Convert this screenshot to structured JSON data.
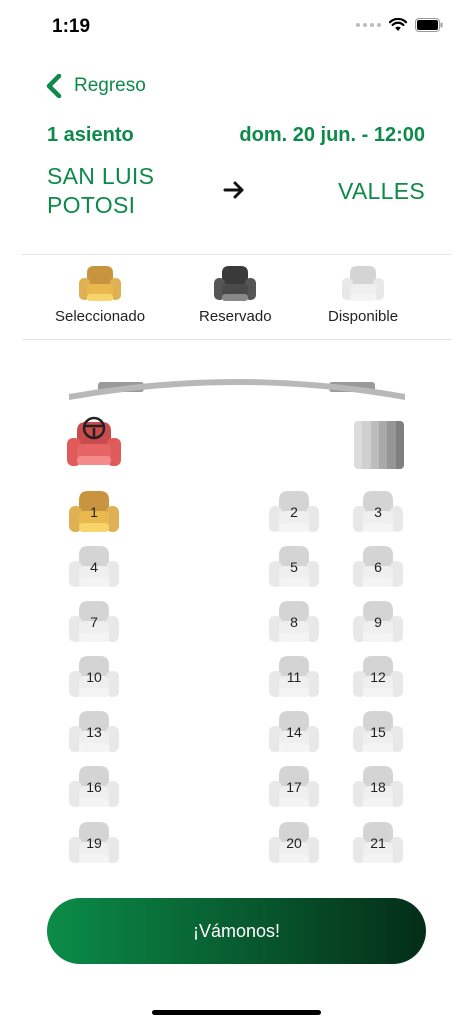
{
  "status_bar": {
    "time": "1:19"
  },
  "header": {
    "back_label": "Regreso",
    "seat_count": "1 asiento",
    "departure": "dom. 20 jun. - 12:00",
    "origin": "SAN LUIS POTOSI",
    "destination": "VALLES"
  },
  "legend": [
    {
      "label": "Seleccionado",
      "state": "selected"
    },
    {
      "label": "Reservado",
      "state": "reserved"
    },
    {
      "label": "Disponible",
      "state": "available"
    }
  ],
  "colors": {
    "brand_green": "#0d8a4a",
    "selected_seat": "#e0b154",
    "reserved_seat": "#555555",
    "available_seat": "#e2e2e2",
    "driver_seat": "#e06262"
  },
  "seats": [
    {
      "number": "1",
      "state": "selected"
    },
    {
      "number": "2",
      "state": "available"
    },
    {
      "number": "3",
      "state": "available"
    },
    {
      "number": "4",
      "state": "available"
    },
    {
      "number": "5",
      "state": "available"
    },
    {
      "number": "6",
      "state": "available"
    },
    {
      "number": "7",
      "state": "available"
    },
    {
      "number": "8",
      "state": "available"
    },
    {
      "number": "9",
      "state": "available"
    },
    {
      "number": "10",
      "state": "available"
    },
    {
      "number": "11",
      "state": "available"
    },
    {
      "number": "12",
      "state": "available"
    },
    {
      "number": "13",
      "state": "available"
    },
    {
      "number": "14",
      "state": "available"
    },
    {
      "number": "15",
      "state": "available"
    },
    {
      "number": "16",
      "state": "available"
    },
    {
      "number": "17",
      "state": "available"
    },
    {
      "number": "18",
      "state": "available"
    },
    {
      "number": "19",
      "state": "available"
    },
    {
      "number": "20",
      "state": "available"
    },
    {
      "number": "21",
      "state": "available"
    }
  ],
  "cta": {
    "label": "¡Vámonos!"
  }
}
